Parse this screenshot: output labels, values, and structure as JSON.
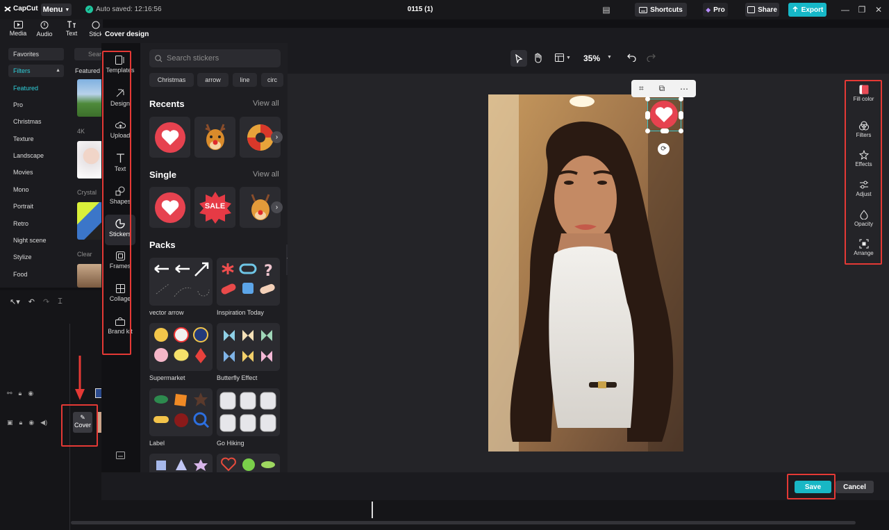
{
  "titlebar": {
    "logo": "CapCut",
    "menu": "Menu",
    "autosave": "Auto saved: 12:16:56",
    "project": "0115 (1)",
    "shortcuts": "Shortcuts",
    "pro": "Pro",
    "share": "Share",
    "export": "Export"
  },
  "toolstrip": [
    {
      "label": "Media",
      "icon": "media-icon"
    },
    {
      "label": "Audio",
      "icon": "audio-icon"
    },
    {
      "label": "Text",
      "icon": "text-icon"
    },
    {
      "label": "Stick",
      "icon": "sticker-icon"
    }
  ],
  "leftpanel": {
    "search_placeholder": "Sear",
    "featured_heading": "Featured",
    "categories": [
      "Favorites",
      "Filters",
      "Featured",
      "Pro",
      "Christmas",
      "Texture",
      "Landscape",
      "Movies",
      "Mono",
      "Portrait",
      "Retro",
      "Night scene",
      "Stylize",
      "Food"
    ],
    "thumb_labels": [
      "4K",
      "Crystal",
      "Clear"
    ]
  },
  "timeline": {
    "cover_label": "Cover"
  },
  "cover_design": {
    "title": "Cover design",
    "tabs": [
      {
        "label": "Templates",
        "icon": "templates-icon"
      },
      {
        "label": "Design",
        "icon": "design-icon"
      },
      {
        "label": "Upload",
        "icon": "upload-icon"
      },
      {
        "label": "Text",
        "icon": "text-icon"
      },
      {
        "label": "Shapes",
        "icon": "shapes-icon"
      },
      {
        "label": "Stickers",
        "icon": "stickers-icon"
      },
      {
        "label": "Frames",
        "icon": "frames-icon"
      },
      {
        "label": "Collage",
        "icon": "collage-icon"
      },
      {
        "label": "Brand kit",
        "icon": "brand-kit-icon"
      }
    ],
    "stickers": {
      "search_placeholder": "Search stickers",
      "chips": [
        "Christmas",
        "arrow",
        "line",
        "circ"
      ],
      "recents_title": "Recents",
      "single_title": "Single",
      "view_all": "View all",
      "packs_title": "Packs",
      "sale_text": "SALE",
      "packs": [
        "vector arrow",
        "Inspiration Today",
        "Supermarket",
        "Butterfly Effect",
        "Label",
        "Go Hiking"
      ]
    },
    "canvas": {
      "zoom": "35%"
    },
    "properties": [
      {
        "label": "Fill color",
        "icon": "fill-color-icon"
      },
      {
        "label": "Filters",
        "icon": "filters-icon"
      },
      {
        "label": "Effects",
        "icon": "effects-icon"
      },
      {
        "label": "Adjust",
        "icon": "adjust-icon"
      },
      {
        "label": "Opacity",
        "icon": "opacity-icon"
      },
      {
        "label": "Arrange",
        "icon": "arrange-icon"
      }
    ],
    "save": "Save",
    "cancel": "Cancel"
  },
  "colors": {
    "accent": "#16b8c8",
    "highlight": "#e53935",
    "heart": "#e6424f"
  }
}
